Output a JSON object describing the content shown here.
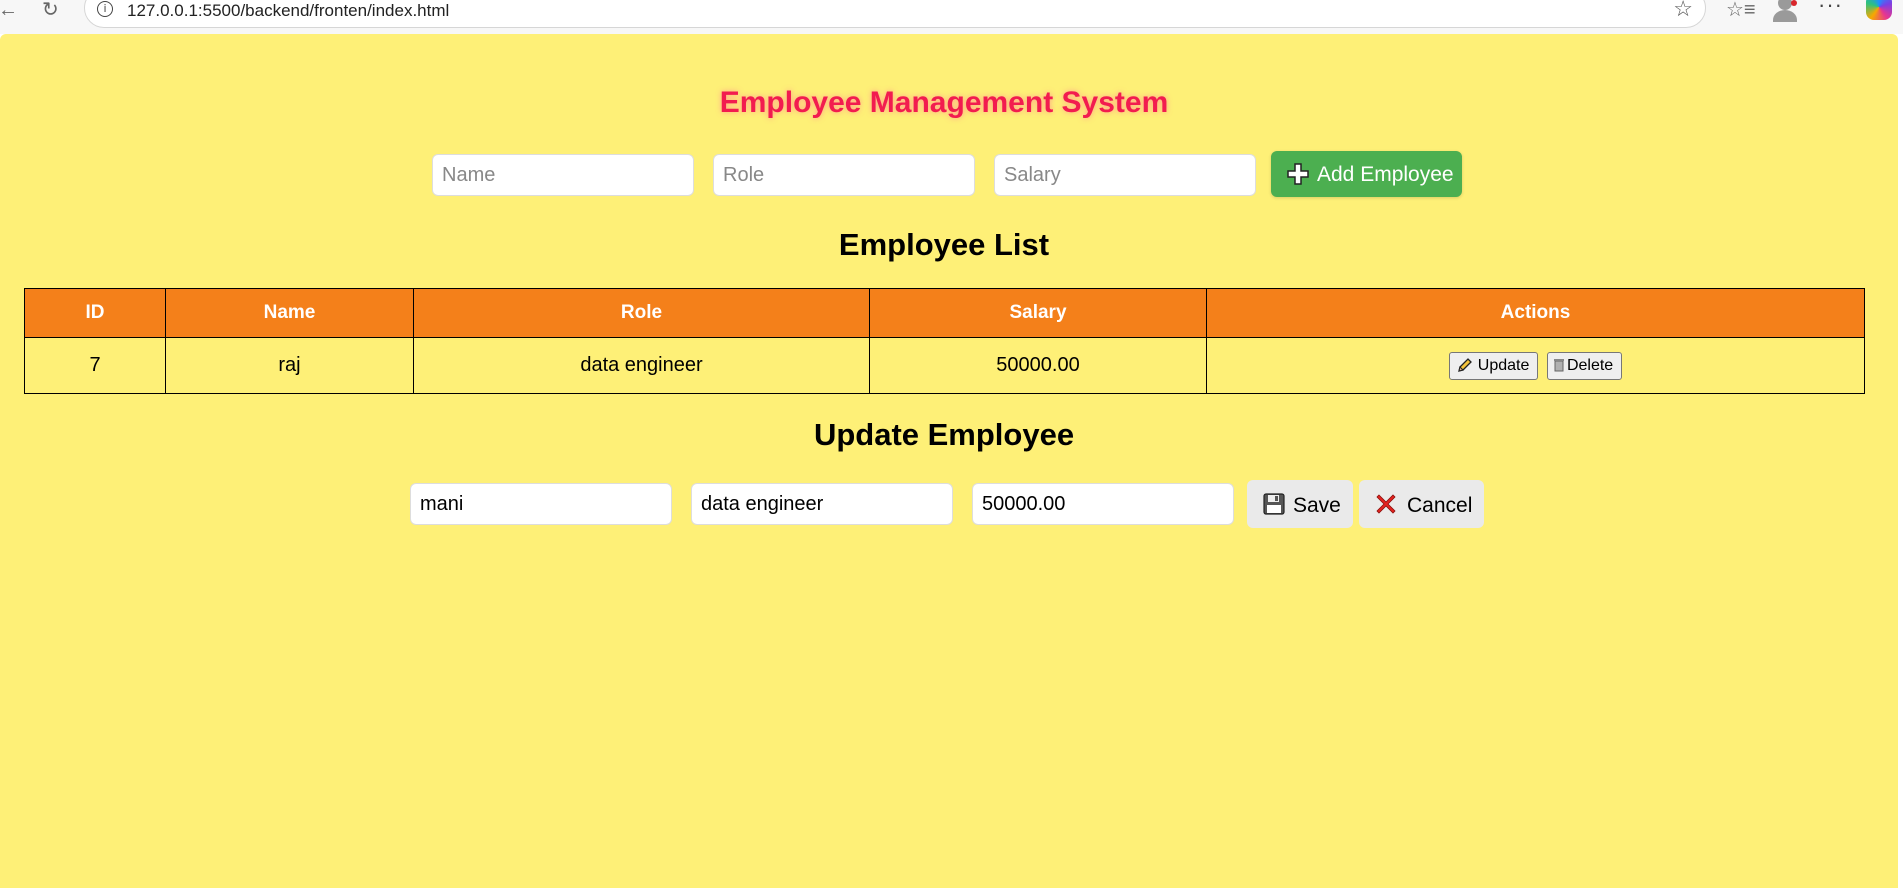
{
  "browser": {
    "url": "127.0.0.1:5500/backend/fronten/index.html"
  },
  "page": {
    "title": "Employee Management System",
    "add_form": {
      "name_placeholder": "Name",
      "role_placeholder": "Role",
      "salary_placeholder": "Salary",
      "add_label": "Add Employee"
    },
    "list_heading": "Employee List",
    "table": {
      "headers": [
        "ID",
        "Name",
        "Role",
        "Salary",
        "Actions"
      ],
      "rows": [
        {
          "id": "7",
          "name": "raj",
          "role": "data engineer",
          "salary": "50000.00"
        }
      ],
      "update_label": "Update",
      "delete_label": "Delete"
    },
    "update_heading": "Update Employee",
    "update_form": {
      "name_value": "mani",
      "role_value": "data engineer",
      "salary_value": "50000.00",
      "save_label": "Save",
      "cancel_label": "Cancel"
    }
  },
  "colors": {
    "page_background": "#fef077",
    "title": "#f21c4f",
    "table_header": "#f4801a",
    "add_button": "#4caf50"
  }
}
